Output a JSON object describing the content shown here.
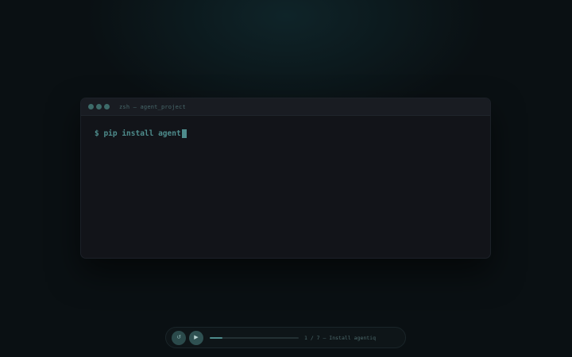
{
  "terminal": {
    "title": "zsh — agent_project",
    "prompt": "$ pip install agent",
    "window_dot_color": "#3d6b69",
    "text_color": "#4e8c8c"
  },
  "controls": {
    "prev_icon": "prev-step-icon",
    "play_icon": "play-icon",
    "progress": 0.14,
    "step_label": "1 / 7 — Install agentiq"
  }
}
